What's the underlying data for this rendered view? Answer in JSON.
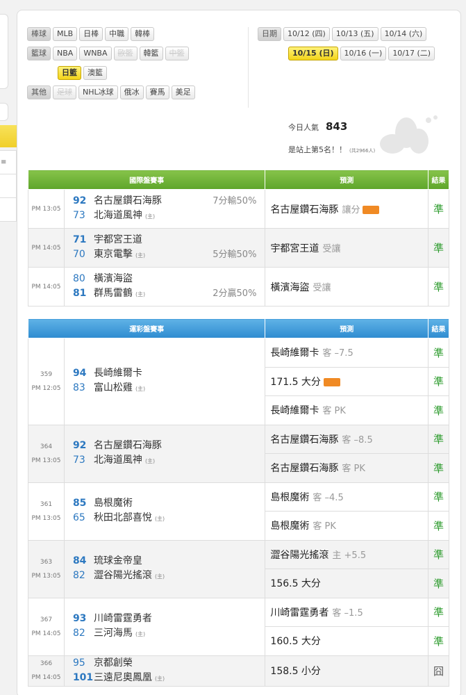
{
  "filters": {
    "baseball": {
      "label": "棒球",
      "items": [
        "MLB",
        "日棒",
        "中職",
        "韓棒"
      ]
    },
    "basketball": {
      "label": "籃球",
      "items": [
        "NBA",
        "WNBA",
        "歐籃",
        "韓籃",
        "中籃"
      ],
      "row2": [
        "日籃",
        "澳籃"
      ]
    },
    "other": {
      "label": "其他",
      "items": [
        "足球",
        "NHL冰球",
        "俄冰",
        "賽馬",
        "美足"
      ]
    },
    "date": {
      "label": "日期",
      "row1": [
        "10/12 (四)",
        "10/13 (五)",
        "10/14 (六)"
      ],
      "row2": [
        "10/15 (日)",
        "10/16 (一)",
        "10/17 (二)"
      ]
    }
  },
  "popularity": {
    "label": "今日人氣",
    "value": "843",
    "rank_text": "是站上第5名！！",
    "rank_note": "(共2966人)"
  },
  "intl_table": {
    "headers": [
      "國際盤賽事",
      "預測",
      "結果"
    ],
    "rows": [
      {
        "time": "PM 13:05",
        "away_score": "92",
        "away": "名古屋鑽石海豚",
        "home_score": "73",
        "home": "北海道風神",
        "home_mark": "(主)",
        "handicap": "7分輸50%",
        "hc_row": "away",
        "pred": "名古屋鑽石海豚",
        "pred_extra": "讓分",
        "badge": true,
        "result": "準"
      },
      {
        "time": "PM 14:05",
        "away_score": "71",
        "away": "宇都宮王道",
        "home_score": "70",
        "home": "東京電擊",
        "home_mark": "(主)",
        "handicap": "5分輸50%",
        "hc_row": "home",
        "pred": "宇都宮王道",
        "pred_extra": "受讓",
        "badge": false,
        "result": "準"
      },
      {
        "time": "PM 14:05",
        "away_score": "80",
        "away": "橫濱海盜",
        "home_score": "81",
        "home": "群馬雷鶴",
        "home_mark": "(主)",
        "handicap": "2分贏50%",
        "hc_row": "home",
        "pred": "橫濱海盜",
        "pred_extra": "受讓",
        "badge": false,
        "result": "準"
      }
    ]
  },
  "lottery_table": {
    "headers": [
      "運彩盤賽事",
      "預測",
      "結果"
    ],
    "games": [
      {
        "no": "359",
        "time": "PM 12:05",
        "away_score": "94",
        "away": "長崎維爾卡",
        "home_score": "83",
        "home": "富山松雞",
        "home_mark": "(主)",
        "preds": [
          {
            "main": "長崎維爾卡",
            "extra": "客 –7.5",
            "badge": false,
            "result": "準"
          },
          {
            "main": "171.5 大分",
            "extra": "",
            "badge": true,
            "result": "準"
          },
          {
            "main": "長崎維爾卡",
            "extra": "客 PK",
            "badge": false,
            "result": "準"
          }
        ]
      },
      {
        "no": "364",
        "time": "PM 13:05",
        "away_score": "92",
        "away": "名古屋鑽石海豚",
        "home_score": "73",
        "home": "北海道風神",
        "home_mark": "(主)",
        "preds": [
          {
            "main": "名古屋鑽石海豚",
            "extra": "客 –8.5",
            "badge": false,
            "result": "準"
          },
          {
            "main": "名古屋鑽石海豚",
            "extra": "客 PK",
            "badge": false,
            "result": "準"
          }
        ]
      },
      {
        "no": "361",
        "time": "PM 13:05",
        "away_score": "85",
        "away": "島根魔術",
        "home_score": "65",
        "home": "秋田北部喜悅",
        "home_mark": "(主)",
        "preds": [
          {
            "main": "島根魔術",
            "extra": "客 –4.5",
            "badge": false,
            "result": "準"
          },
          {
            "main": "島根魔術",
            "extra": "客 PK",
            "badge": false,
            "result": "準"
          }
        ]
      },
      {
        "no": "363",
        "time": "PM 13:05",
        "away_score": "84",
        "away": "琉球金帝皇",
        "home_score": "82",
        "home": "澀谷陽光搖滾",
        "home_mark": "(主)",
        "preds": [
          {
            "main": "澀谷陽光搖滾",
            "extra": "主 +5.5",
            "badge": false,
            "result": "準"
          },
          {
            "main": "156.5 大分",
            "extra": "",
            "badge": false,
            "result": "準"
          }
        ]
      },
      {
        "no": "367",
        "time": "PM 14:05",
        "away_score": "93",
        "away": "川崎雷霆勇者",
        "home_score": "82",
        "home": "三河海馬",
        "home_mark": "(主)",
        "preds": [
          {
            "main": "川崎雷霆勇者",
            "extra": "客 –1.5",
            "badge": false,
            "result": "準"
          },
          {
            "main": "160.5 大分",
            "extra": "",
            "badge": false,
            "result": "準"
          }
        ]
      },
      {
        "no": "366",
        "time": "PM 14:05",
        "away_score": "95",
        "away": "京都創榮",
        "home_score": "101",
        "home": "三遠尼奧鳳凰",
        "home_mark": "(主)",
        "preds": [
          {
            "main": "158.5 小分",
            "extra": "",
            "badge": false,
            "result": "囧"
          }
        ]
      }
    ]
  },
  "colors": {
    "green_header": "#6aad35",
    "blue_header": "#3d98d8",
    "accent": "#f3d41a",
    "win": "#2a9a2a"
  }
}
